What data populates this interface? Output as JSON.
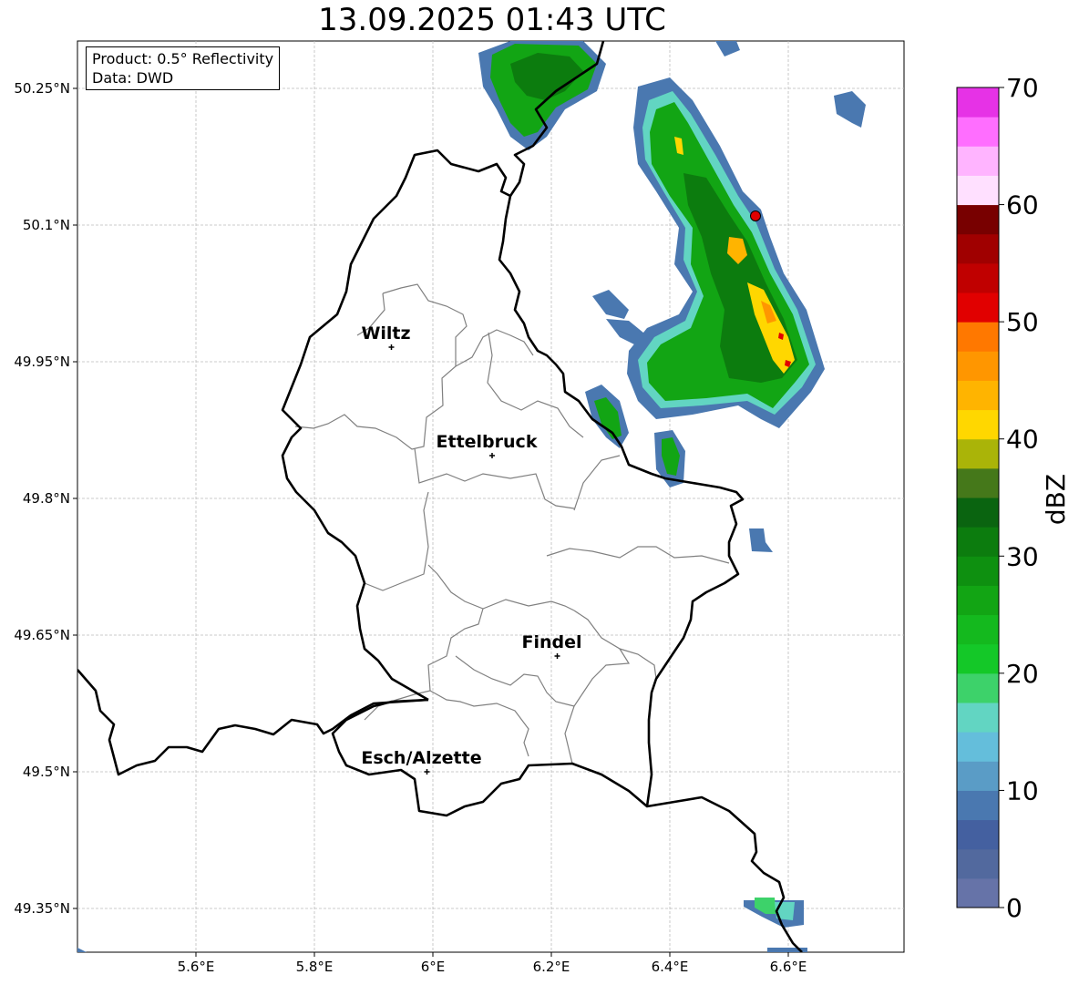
{
  "header": {
    "title": "13.09.2025 01:43 UTC"
  },
  "info_box": {
    "product": "Product: 0.5° Reflectivity",
    "data": "Data: DWD"
  },
  "map": {
    "lat_ticks": [
      "50.25°N",
      "50.1°N",
      "49.95°N",
      "49.8°N",
      "49.65°N",
      "49.5°N",
      "49.35°N"
    ],
    "lon_ticks": [
      "5.6°E",
      "5.8°E",
      "6°E",
      "6.2°E",
      "6.4°E",
      "6.6°E"
    ],
    "cities": [
      {
        "name": "Wiltz",
        "lon": 5.93,
        "lat": 49.966
      },
      {
        "name": "Ettelbruck",
        "lon": 6.1,
        "lat": 49.847
      },
      {
        "name": "Findel",
        "lon": 6.21,
        "lat": 49.627
      },
      {
        "name": "Esch/Alzette",
        "lon": 5.99,
        "lat": 49.5
      }
    ],
    "marker": {
      "color": "#e00000"
    }
  },
  "colorbar": {
    "label": "dBZ",
    "ticks": [
      "0",
      "10",
      "20",
      "30",
      "40",
      "50",
      "60",
      "70"
    ],
    "colors": [
      "#6673a8",
      "#52699e",
      "#4460a0",
      "#4a78b0",
      "#5a9cc6",
      "#64bedb",
      "#62d5c2",
      "#3dd26a",
      "#14c828",
      "#14b91e",
      "#12a514",
      "#0e9010",
      "#0c7c0e",
      "#0a6410",
      "#45781a",
      "#aab408",
      "#ffd700",
      "#ffb400",
      "#ff9600",
      "#ff7800",
      "#e10000",
      "#c00000",
      "#a00000",
      "#780000",
      "#ffe0ff",
      "#ffb4ff",
      "#ff6eff",
      "#e632e6"
    ]
  }
}
